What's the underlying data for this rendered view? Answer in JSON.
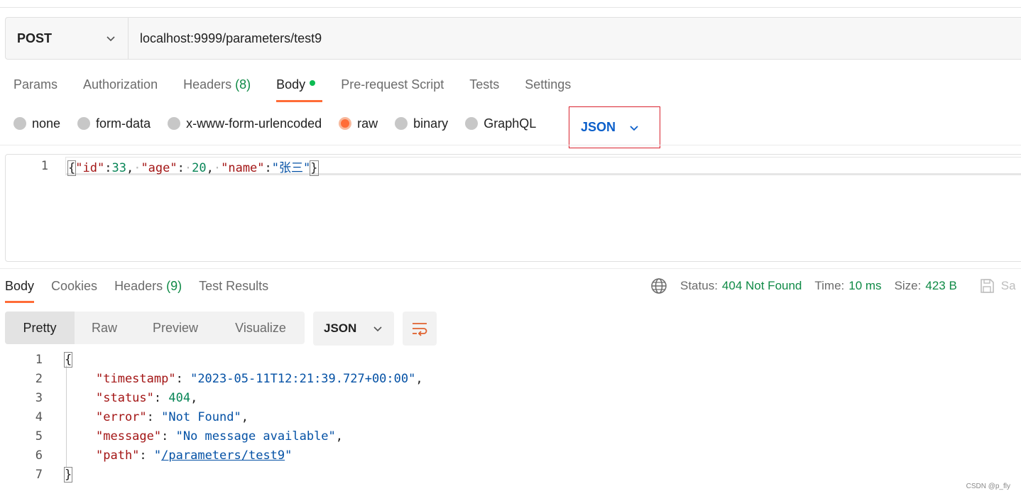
{
  "request": {
    "method": "POST",
    "url": "localhost:9999/parameters/test9",
    "tabs": [
      {
        "label": "Params"
      },
      {
        "label": "Authorization"
      },
      {
        "label": "Headers",
        "count": "(8)"
      },
      {
        "label": "Body"
      },
      {
        "label": "Pre-request Script"
      },
      {
        "label": "Tests"
      },
      {
        "label": "Settings"
      }
    ],
    "body_types": [
      "none",
      "form-data",
      "x-www-form-urlencoded",
      "raw",
      "binary",
      "GraphQL"
    ],
    "selected_body_type": "raw",
    "body_format": "JSON",
    "editor": {
      "line_number": "1",
      "tokens": {
        "open": "{",
        "k_id": "\"id\"",
        "v_id": "33",
        "k_age": "\"age\"",
        "v_age": "20",
        "k_name": "\"name\"",
        "v_name": "\"张三\"",
        "close": "}"
      }
    }
  },
  "response": {
    "tabs": [
      {
        "label": "Body"
      },
      {
        "label": "Cookies"
      },
      {
        "label": "Headers",
        "count": "(9)"
      },
      {
        "label": "Test Results"
      }
    ],
    "status_label": "Status:",
    "status_value": "404 Not Found",
    "time_label": "Time:",
    "time_value": "10 ms",
    "size_label": "Size:",
    "size_value": "423 B",
    "save_label": "Sa",
    "views": [
      "Pretty",
      "Raw",
      "Preview",
      "Visualize"
    ],
    "active_view": "Pretty",
    "format": "JSON",
    "lines": [
      {
        "n": "1",
        "open": "{"
      },
      {
        "n": "2",
        "key": "\"timestamp\"",
        "value": "\"2023-05-11T12:21:39.727+00:00\""
      },
      {
        "n": "3",
        "key": "\"status\"",
        "value": "404"
      },
      {
        "n": "4",
        "key": "\"error\"",
        "value": "\"Not Found\""
      },
      {
        "n": "5",
        "key": "\"message\"",
        "value": "\"No message available\""
      },
      {
        "n": "6",
        "key": "\"path\"",
        "value_prefix": "\"",
        "value_link": "/parameters/test9",
        "value_suffix": "\""
      },
      {
        "n": "7",
        "close": "}"
      }
    ]
  },
  "watermark": "CSDN @p_fly",
  "colors": {
    "accent": "#ff6c37",
    "status_green": "#0f8a46",
    "highlight_border": "#d9232e",
    "format_blue": "#0b5fca"
  },
  "icons": {
    "method_chevron": "chevron-down-icon",
    "globe": "globe-icon",
    "save": "save-icon",
    "wrap": "wrap-lines-icon"
  }
}
